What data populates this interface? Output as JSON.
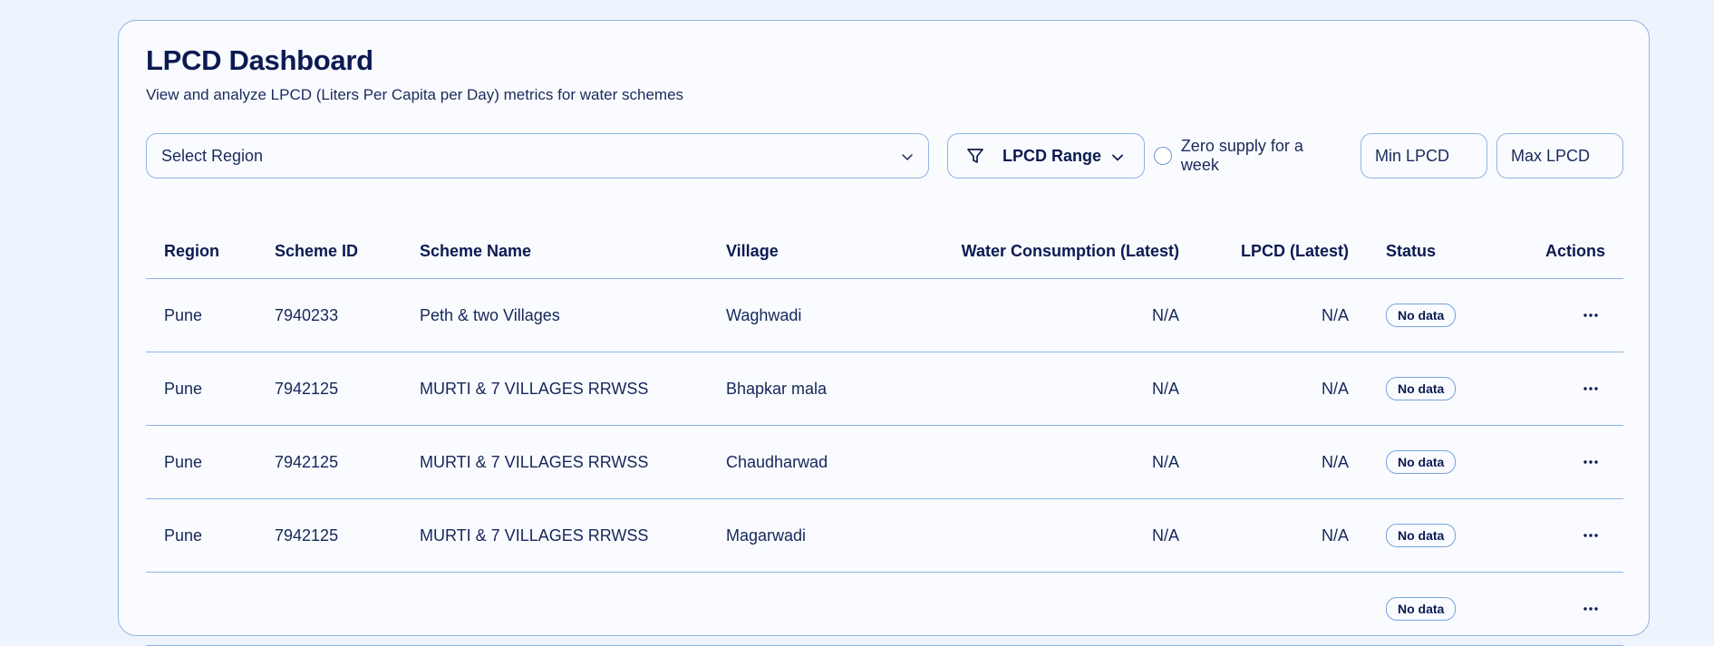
{
  "header": {
    "title": "LPCD Dashboard",
    "subtitle": "View and analyze LPCD (Liters Per Capita per Day) metrics for water schemes"
  },
  "filters": {
    "region_select": "Select Region",
    "lpcd_range_label": "LPCD Range",
    "zero_supply_label": "Zero supply for a week",
    "min_placeholder": "Min LPCD",
    "max_placeholder": "Max LPCD"
  },
  "table": {
    "columns": [
      "Region",
      "Scheme ID",
      "Scheme Name",
      "Village",
      "Water Consumption (Latest)",
      "LPCD (Latest)",
      "Status",
      "Actions"
    ],
    "rows": [
      {
        "region": "Pune",
        "scheme_id": "7940233",
        "scheme_name": "Peth & two Villages",
        "village": "Waghwadi",
        "water": "N/A",
        "lpcd": "N/A",
        "status": "No data"
      },
      {
        "region": "Pune",
        "scheme_id": "7942125",
        "scheme_name": "MURTI & 7 VILLAGES RRWSS",
        "village": "Bhapkar mala",
        "water": "N/A",
        "lpcd": "N/A",
        "status": "No data"
      },
      {
        "region": "Pune",
        "scheme_id": "7942125",
        "scheme_name": "MURTI & 7 VILLAGES RRWSS",
        "village": "Chaudharwad",
        "water": "N/A",
        "lpcd": "N/A",
        "status": "No data"
      },
      {
        "region": "Pune",
        "scheme_id": "7942125",
        "scheme_name": "MURTI & 7 VILLAGES RRWSS",
        "village": "Magarwadi",
        "water": "N/A",
        "lpcd": "N/A",
        "status": "No data"
      },
      {
        "region": "",
        "scheme_id": "",
        "scheme_name": "",
        "village": "",
        "water": "",
        "lpcd": "",
        "status": "No data"
      }
    ]
  },
  "icons": {
    "region_chevron": "chevron-down-icon",
    "range_filter": "filter-icon",
    "range_chevron": "chevron-down-icon",
    "row_actions": "more-horizontal-icon"
  },
  "colors": {
    "background": "#edf4fd",
    "card": "#f9fbfe",
    "border": "#8fb3e6",
    "text": "#0c1a52"
  }
}
